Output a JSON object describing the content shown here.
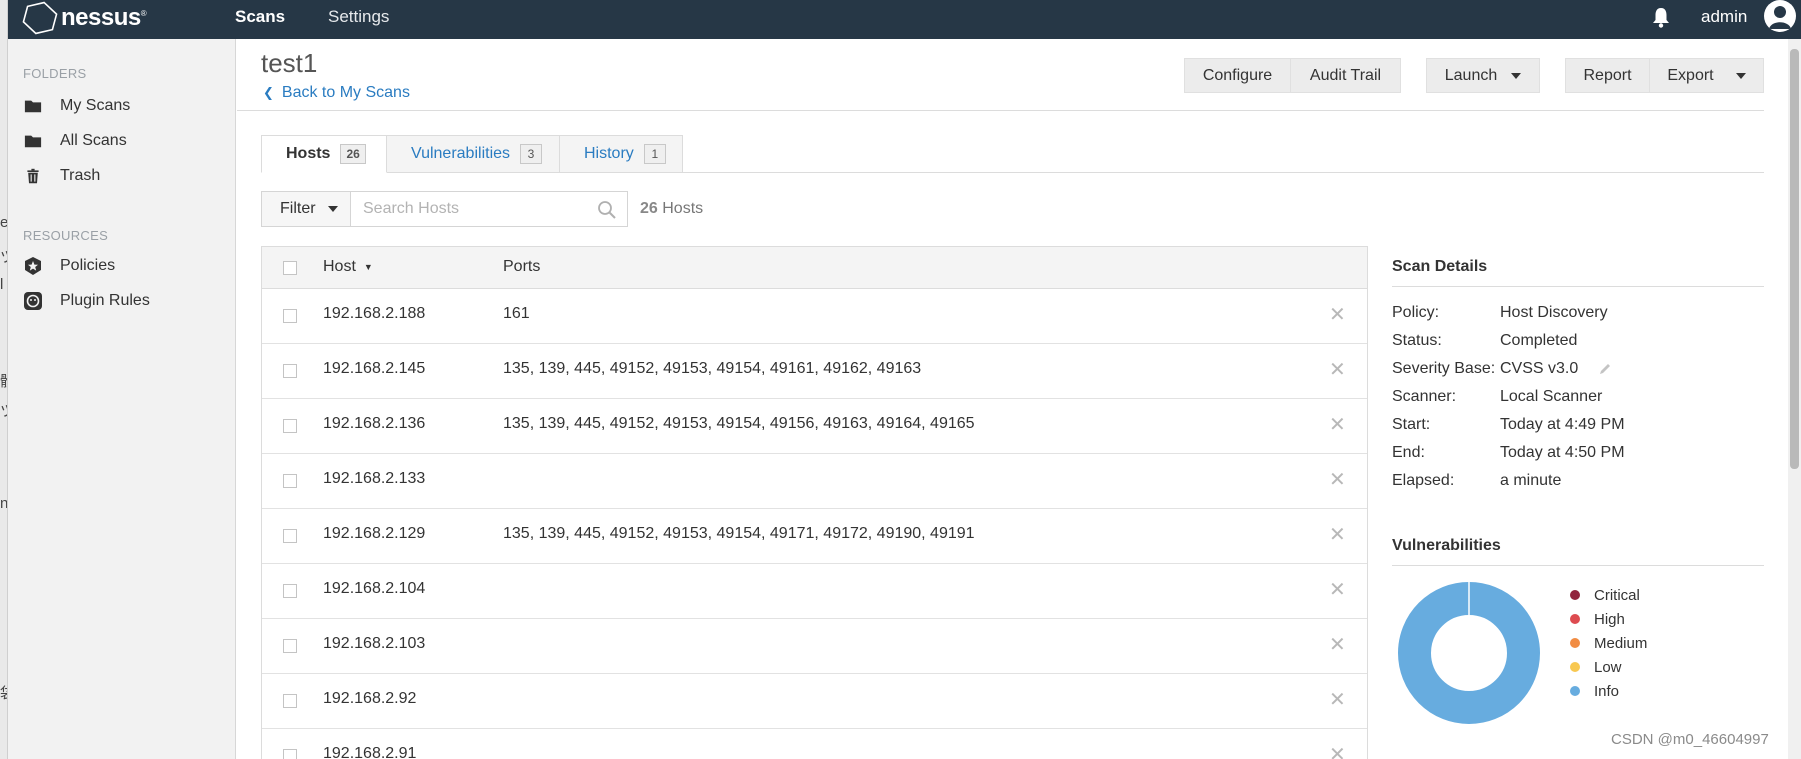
{
  "topbar": {
    "logo_text": "nessus",
    "logo_mark": "®",
    "nav": [
      {
        "label": "Scans"
      },
      {
        "label": "Settings"
      }
    ],
    "user": "admin"
  },
  "sidebar": {
    "folders_heading": "FOLDERS",
    "folders": [
      {
        "label": "My Scans",
        "icon": "folder-icon"
      },
      {
        "label": "All Scans",
        "icon": "folder-icon"
      },
      {
        "label": "Trash",
        "icon": "trash-icon"
      }
    ],
    "resources_heading": "RESOURCES",
    "resources": [
      {
        "label": "Policies",
        "icon": "policy-shield-icon"
      },
      {
        "label": "Plugin Rules",
        "icon": "plugin-rules-icon"
      }
    ]
  },
  "header": {
    "title": "test1",
    "back_link": "Back to My Scans",
    "buttons": {
      "configure": "Configure",
      "audit_trail": "Audit Trail",
      "launch": "Launch",
      "report": "Report",
      "export": "Export"
    }
  },
  "tabs": [
    {
      "label": "Hosts",
      "count": "26",
      "active": true
    },
    {
      "label": "Vulnerabilities",
      "count": "3",
      "active": false
    },
    {
      "label": "History",
      "count": "1",
      "active": false
    }
  ],
  "filter": {
    "label": "Filter",
    "search_placeholder": "Search Hosts",
    "count": "26",
    "count_suffix": "Hosts"
  },
  "table": {
    "columns": [
      "Host",
      "Ports"
    ],
    "rows": [
      {
        "host": "192.168.2.188",
        "ports": "161"
      },
      {
        "host": "192.168.2.145",
        "ports": "135, 139, 445, 49152, 49153, 49154, 49161, 49162, 49163"
      },
      {
        "host": "192.168.2.136",
        "ports": "135, 139, 445, 49152, 49153, 49154, 49156, 49163, 49164, 49165"
      },
      {
        "host": "192.168.2.133",
        "ports": ""
      },
      {
        "host": "192.168.2.129",
        "ports": "135, 139, 445, 49152, 49153, 49154, 49171, 49172, 49190, 49191"
      },
      {
        "host": "192.168.2.104",
        "ports": ""
      },
      {
        "host": "192.168.2.103",
        "ports": ""
      },
      {
        "host": "192.168.2.92",
        "ports": ""
      },
      {
        "host": "192.168.2.91",
        "ports": ""
      }
    ]
  },
  "scan_details": {
    "heading": "Scan Details",
    "items": [
      {
        "label": "Policy:",
        "value": "Host Discovery"
      },
      {
        "label": "Status:",
        "value": "Completed"
      },
      {
        "label": "Severity Base:",
        "value": "CVSS v3.0"
      },
      {
        "label": "Scanner:",
        "value": "Local Scanner"
      },
      {
        "label": "Start:",
        "value": "Today at 4:49 PM"
      },
      {
        "label": "End:",
        "value": "Today at 4:50 PM"
      },
      {
        "label": "Elapsed:",
        "value": "a minute"
      }
    ]
  },
  "vulnerabilities": {
    "heading": "Vulnerabilities",
    "legend": [
      {
        "label": "Critical",
        "color": "#91243e"
      },
      {
        "label": "High",
        "color": "#dd4b50"
      },
      {
        "label": "Medium",
        "color": "#f18c43"
      },
      {
        "label": "Low",
        "color": "#f8c851"
      },
      {
        "label": "Info",
        "color": "#67acdf"
      }
    ],
    "chart_data": {
      "type": "pie",
      "categories": [
        "Critical",
        "High",
        "Medium",
        "Low",
        "Info"
      ],
      "values": [
        0,
        0,
        0,
        0,
        100
      ]
    }
  },
  "edge_glyphs": [
    "e",
    "ツ",
    "l",
    "骸",
    "ツ",
    "n",
    "袋"
  ],
  "watermark": "CSDN @m0_46604997"
}
